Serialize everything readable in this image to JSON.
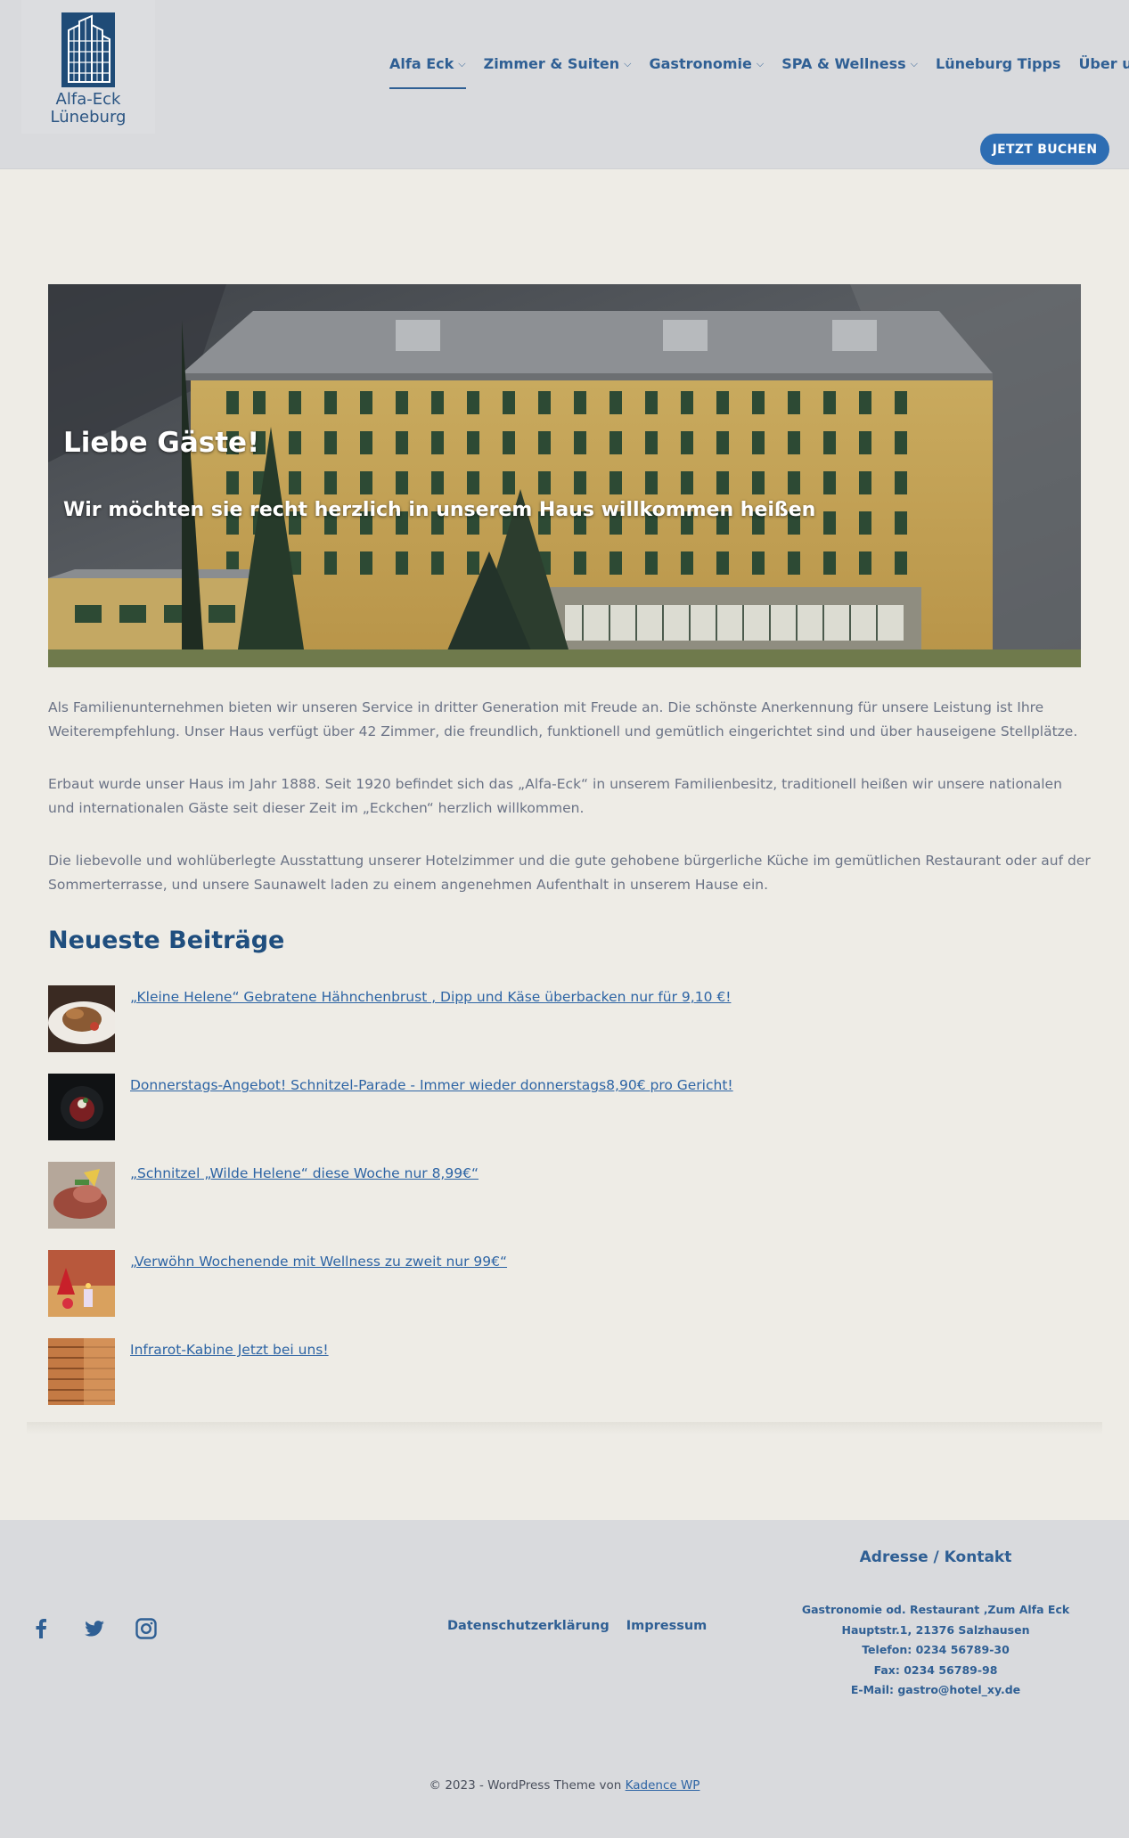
{
  "header": {
    "logo_line1": "Alfa-Eck",
    "logo_line2": "Lüneburg",
    "nav": [
      {
        "label": "Alfa Eck",
        "dropdown": true,
        "active": true
      },
      {
        "label": "Zimmer & Suiten",
        "dropdown": true
      },
      {
        "label": "Gastronomie",
        "dropdown": true
      },
      {
        "label": "SPA & Wellness",
        "dropdown": true
      },
      {
        "label": "Lüneburg Tipps",
        "dropdown": false
      },
      {
        "label": "Über uns",
        "dropdown": true
      }
    ],
    "chevron": "⌵",
    "book_label": "JETZT BUCHEN"
  },
  "hero": {
    "title": "Liebe Gäste!",
    "subtitle": "Wir möchten sie recht herzlich in unserem Haus willkommen heißen"
  },
  "intro": [
    "Als Familienunternehmen bieten wir unseren Service in dritter Generation mit Freude an. Die schönste Anerkennung für unsere Leistung ist Ihre Weiterempfehlung. Unser Haus verfügt über 42 Zimmer, die freundlich, funktionell und gemütlich eingerichtet sind und über hauseigene Stellplätze.",
    "Erbaut wurde unser Haus im Jahr 1888. Seit 1920 befindet sich das „Alfa-Eck“ in unserem Familienbesitz, traditionell heißen wir unsere nationalen und internationalen Gäste seit dieser Zeit im „Eckchen“ herzlich willkommen.",
    "Die liebevolle und wohlüberlegte Ausstattung unserer Hotelzimmer und die gute gehobene bürgerliche Küche im gemütlichen Restaurant oder auf der Sommerterrasse, und unsere Saunawelt laden zu einem angenehmen Aufenthalt in unserem Hause ein."
  ],
  "recent": {
    "title": "Neueste Beiträge",
    "posts": [
      {
        "title": "„Kleine Helene“ Gebratene Hähnchenbrust , Dipp und Käse überbacken nur für 9,10 €!"
      },
      {
        "title": "Donnerstags-Angebot! Schnitzel-Parade - Immer wieder donnerstags8,90€ pro Gericht!"
      },
      {
        "title": "„Schnitzel „Wilde Helene“ diese Woche nur 8,99€“"
      },
      {
        "title": "„Verwöhn Wochenende mit Wellness zu zweit nur 99€“"
      },
      {
        "title": "Infrarot-Kabine Jetzt bei uns!"
      }
    ]
  },
  "footer": {
    "social": [
      "facebook-icon",
      "twitter-icon",
      "instagram-icon"
    ],
    "links": [
      "Datenschutzerklärung",
      "Impressum"
    ],
    "contact_title": "Adresse / Kontakt",
    "contact_lines": [
      "Gastronomie od. Restaurant ‚Zum Alfa Eck",
      "Hauptstr.1, 21376 Salzhausen",
      "Telefon: 0234 56789-30",
      "Fax: 0234 56789-98",
      "E-Mail: gastro@hotel_xy.de"
    ],
    "copyright_prefix": "© 2023 - WordPress Theme von",
    "copyright_link": "Kadence WP"
  },
  "colors": {
    "header_bg": "#d9dadd",
    "page_bg": "#eeece6",
    "accent": "#2f5f94",
    "button": "#2d6db3",
    "heading": "#1f4e7e",
    "link": "#2d64a4"
  }
}
